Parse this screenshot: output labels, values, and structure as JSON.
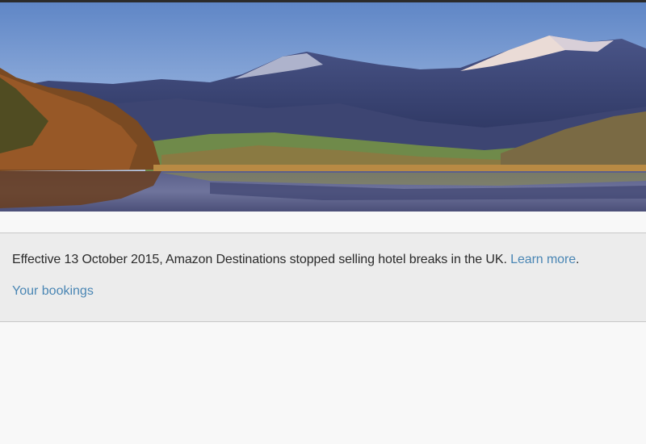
{
  "hero": {
    "image_subject": "mountain-lake-landscape"
  },
  "notice": {
    "message": "Effective 13 October 2015, Amazon Destinations stopped selling hotel breaks in the UK.",
    "learn_more_label": "Learn more",
    "trailing_punctuation": ".",
    "bookings_label": "Your bookings"
  },
  "colors": {
    "link": "#4a86b4",
    "notice_background": "#ececec",
    "page_background": "#f8f8f8",
    "text": "#2a2a2a"
  }
}
